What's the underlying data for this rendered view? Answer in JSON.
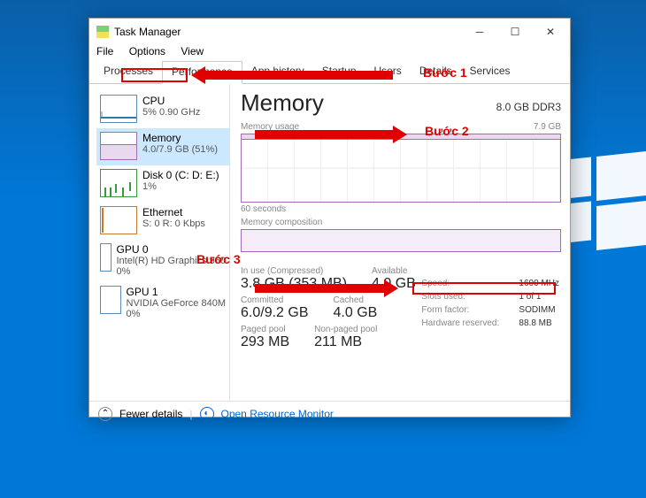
{
  "window": {
    "title": "Task Manager"
  },
  "menu": [
    "File",
    "Options",
    "View"
  ],
  "tabs": [
    "Processes",
    "Performance",
    "App history",
    "Startup",
    "Users",
    "Details",
    "Services"
  ],
  "sidebar": [
    {
      "name": "CPU",
      "sub": "5% 0.90 GHz"
    },
    {
      "name": "Memory",
      "sub": "4.0/7.9 GB (51%)"
    },
    {
      "name": "Disk 0 (C: D: E:)",
      "sub": "1%"
    },
    {
      "name": "Ethernet",
      "sub": "S: 0 R: 0 Kbps"
    },
    {
      "name": "GPU 0",
      "sub": "Intel(R) HD Graphics 550",
      "sub2": "0%"
    },
    {
      "name": "GPU 1",
      "sub": "NVIDIA GeForce 840M",
      "sub2": "0%"
    }
  ],
  "main": {
    "title": "Memory",
    "capacity": "8.0 GB DDR3",
    "usage_label": "Memory usage",
    "usage_max": "7.9 GB",
    "axis": "60 seconds",
    "comp_label": "Memory composition",
    "stats": [
      {
        "label": "In use (Compressed)",
        "value": "3.8 GB (353 MB)"
      },
      {
        "label": "Available",
        "value": "4.0 GB"
      },
      {
        "label": "Committed",
        "value": "6.0/9.2 GB"
      },
      {
        "label": "Cached",
        "value": "4.0 GB"
      },
      {
        "label": "Paged pool",
        "value": "293 MB"
      },
      {
        "label": "Non-paged pool",
        "value": "211 MB"
      }
    ],
    "kv": [
      {
        "k": "Speed:",
        "v": "1600 MHz"
      },
      {
        "k": "Slots used:",
        "v": "1 of 1"
      },
      {
        "k": "Form factor:",
        "v": "SODIMM"
      },
      {
        "k": "Hardware reserved:",
        "v": "88.8 MB"
      }
    ]
  },
  "footer": {
    "fewer": "Fewer details",
    "orm": "Open Resource Monitor"
  },
  "anno": [
    "Bước 1",
    "Bước 2",
    "Bước 3"
  ]
}
